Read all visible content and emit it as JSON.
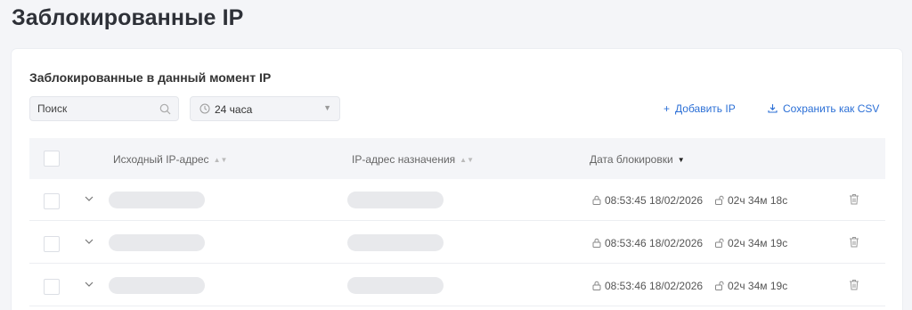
{
  "page": {
    "title": "Заблокированные IP"
  },
  "card": {
    "title": "Заблокированные в данный момент IP",
    "search": {
      "placeholder": "Поиск",
      "value": ""
    },
    "time_filter": {
      "value": "24 часа"
    },
    "actions": {
      "add_ip": "Добавить IP",
      "save_csv": "Сохранить как CSV"
    }
  },
  "table": {
    "columns": {
      "source_ip": "Исходный IP-адрес",
      "dest_ip": "IP-адрес назначения",
      "block_date": "Дата блокировки"
    },
    "rows": [
      {
        "blocked_at": "08:53:45 18/02/2026",
        "duration": "02ч 34м 18с"
      },
      {
        "blocked_at": "08:53:46 18/02/2026",
        "duration": "02ч 34м 19с"
      },
      {
        "blocked_at": "08:53:46 18/02/2026",
        "duration": "02ч 34м 19с"
      }
    ]
  },
  "colors": {
    "accent": "#2b6fd6",
    "background": "#f4f5f8",
    "skeleton": "#e8e9ec"
  },
  "icons": [
    "search-icon",
    "clock-icon",
    "plus-icon",
    "download-icon",
    "chevron-down-icon",
    "lock-icon",
    "unlock-icon",
    "trash-icon"
  ]
}
